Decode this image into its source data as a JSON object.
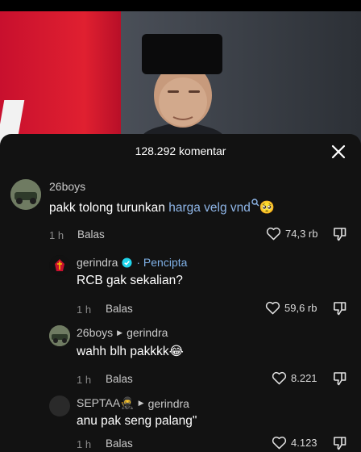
{
  "header": {
    "comment_count": "128.292 komentar"
  },
  "comments": [
    {
      "username": "26boys",
      "text_before": "pakk tolong turunkan ",
      "text_link": "harga velg vnd",
      "text_emoji": "🥺",
      "time": "1 h",
      "reply_label": "Balas",
      "likes": "74,3 rb"
    },
    {
      "username": "gerindra",
      "creator_label": "· Pencipta",
      "text": "RCB gak sekalian?",
      "time": "1 h",
      "reply_label": "Balas",
      "likes": "59,6 rb"
    },
    {
      "username": "26boys",
      "reply_to": "gerindra",
      "text": "wahh blh pakkkk😂",
      "time": "1 h",
      "reply_label": "Balas",
      "likes": "8.221"
    },
    {
      "username": "SEPTAA🥷",
      "reply_to": "gerindra",
      "text": "anu pak seng palang\"",
      "time": "1 h",
      "reply_label": "Balas",
      "likes": "4.123"
    }
  ]
}
